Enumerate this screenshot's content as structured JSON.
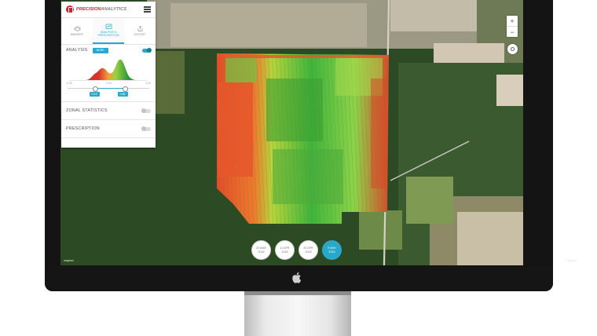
{
  "app": {
    "brand_red": "PRECISION",
    "brand_grey": "ANALYTICS",
    "accent_color": "#2aa8c9",
    "brand_color": "#c8262d"
  },
  "tabs": [
    {
      "label": "IMAGERY",
      "icon": "layers-icon"
    },
    {
      "label": "ANALYSIS & PRESCRIPTION",
      "icon": "chart-icon"
    },
    {
      "label": "EXPORT",
      "icon": "export-icon"
    }
  ],
  "analysis": {
    "label": "ANALYSIS",
    "mode": "NDRE",
    "enabled": true,
    "range_min": "-0.25",
    "range_mid": "0.00",
    "range_max": "1.00",
    "low_value": "0.19",
    "high_value": "0.86",
    "low_fraction": 0.34,
    "high_fraction": 0.7
  },
  "zonal_statistics": {
    "label": "ZONAL STATISTICS",
    "enabled": false
  },
  "prescription": {
    "label": "PRESCRIPTION",
    "enabled": false
  },
  "map": {
    "zoom_in": "+",
    "zoom_out": "−",
    "attribution": "© Mapbox",
    "logo": "mapbox"
  },
  "dates": [
    {
      "day": "20 MAR",
      "year": "2018",
      "active": false
    },
    {
      "day": "11 APR",
      "year": "2018",
      "active": false
    },
    {
      "day": "25 APR",
      "year": "2018",
      "active": false
    },
    {
      "day": "9 MAY",
      "year": "2018",
      "active": true
    }
  ]
}
